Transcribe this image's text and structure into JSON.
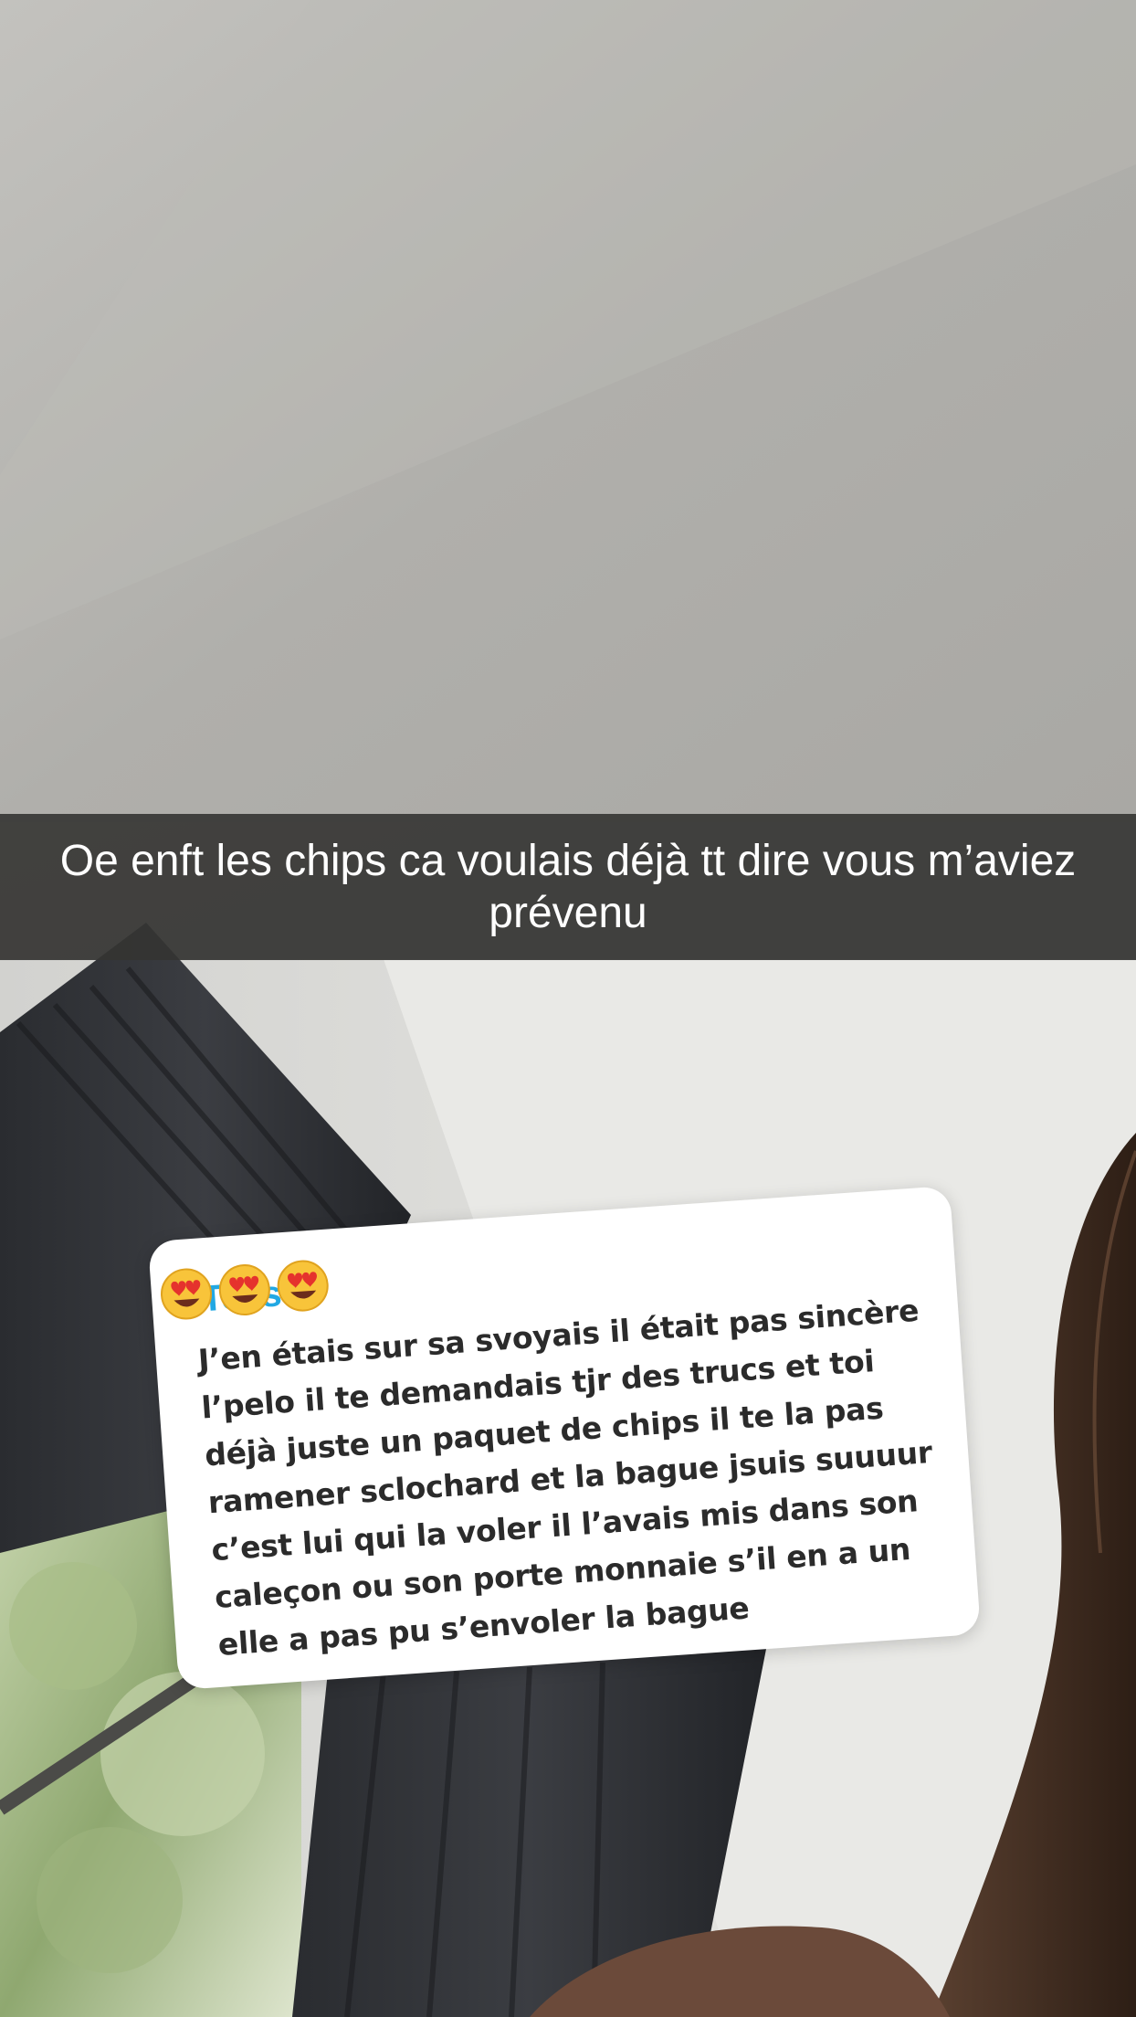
{
  "caption": {
    "text": "Oe enft les chips ca voulais déjà tt dire vous m’aviez prévenu"
  },
  "reply_card": {
    "sender_partial": "Tess",
    "emojis": [
      "heart-eyes-emoji",
      "heart-eyes-emoji",
      "heart-eyes-emoji"
    ],
    "message": "J’en étais sur sa svoyais il était pas sincère l’pelo il te demandais tjr des trucs et toi déjà juste un paquet de chips il te la pas ramener sclochard et la bague jsuis suuuur c’est lui qui la voler il l’avais mis dans son caleçon ou son porte monnaie s’il en a un elle a pas pu s’envoler la bague"
  },
  "colors": {
    "caption_bar": "#343432",
    "card_background": "#ffffff",
    "sender_accent": "#22a8e3",
    "message_text": "#2b2b2b"
  }
}
